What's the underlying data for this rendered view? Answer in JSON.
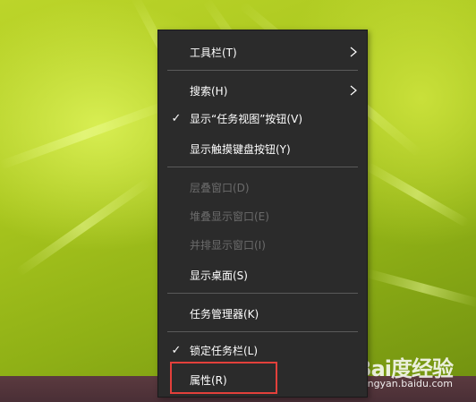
{
  "menu": {
    "items": [
      {
        "label": "工具栏(T)",
        "checked": false,
        "submenu": true,
        "enabled": true
      },
      {
        "label": "搜索(H)",
        "checked": false,
        "submenu": true,
        "enabled": true
      },
      {
        "label": "显示“任务视图”按钮(V)",
        "checked": true,
        "submenu": false,
        "enabled": true
      },
      {
        "label": "显示触摸键盘按钮(Y)",
        "checked": false,
        "submenu": false,
        "enabled": true
      },
      {
        "label": "层叠窗口(D)",
        "checked": false,
        "submenu": false,
        "enabled": false
      },
      {
        "label": "堆叠显示窗口(E)",
        "checked": false,
        "submenu": false,
        "enabled": false
      },
      {
        "label": "并排显示窗口(I)",
        "checked": false,
        "submenu": false,
        "enabled": false
      },
      {
        "label": "显示桌面(S)",
        "checked": false,
        "submenu": false,
        "enabled": true
      },
      {
        "label": "任务管理器(K)",
        "checked": false,
        "submenu": false,
        "enabled": true
      },
      {
        "label": "锁定任务栏(L)",
        "checked": true,
        "submenu": false,
        "enabled": true
      },
      {
        "label": "属性(R)",
        "checked": false,
        "submenu": false,
        "enabled": true
      }
    ],
    "check_glyph": "✓"
  },
  "watermark": {
    "logo": "Bai度经验",
    "site": "jingyan.baidu.com"
  },
  "colors": {
    "menu_bg": "#2b2b2b",
    "menu_text": "#ffffff",
    "disabled_text": "#6b6b6b",
    "highlight_box": "#e3403b",
    "taskbar": "#4a2f36"
  }
}
